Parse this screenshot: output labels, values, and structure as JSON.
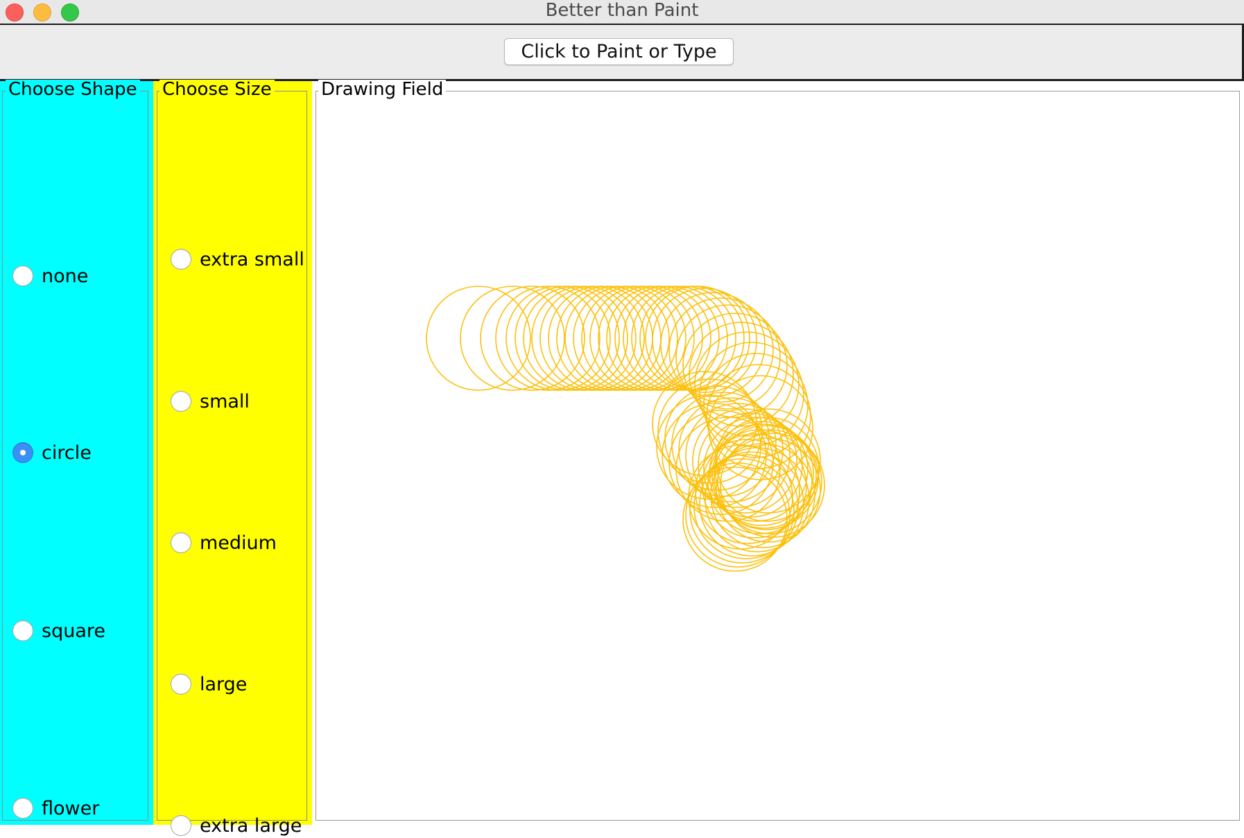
{
  "window": {
    "title": "Better than Paint",
    "traffic_lights": [
      "close-button",
      "minimize-button",
      "zoom-button"
    ]
  },
  "toolbar": {
    "paint_button_label": "Click to Paint or Type"
  },
  "shape_panel": {
    "legend": "Choose Shape",
    "background": "#00ffff",
    "options": [
      {
        "label": "none",
        "checked": false
      },
      {
        "label": "circle",
        "checked": true
      },
      {
        "label": "square",
        "checked": false
      },
      {
        "label": "flower",
        "checked": false
      }
    ]
  },
  "size_panel": {
    "legend": "Choose Size",
    "background": "#ffff00",
    "options": [
      {
        "label": "extra small",
        "checked": false
      },
      {
        "label": "small",
        "checked": false
      },
      {
        "label": "medium",
        "checked": false
      },
      {
        "label": "large",
        "checked": false
      },
      {
        "label": "extra large",
        "checked": false
      }
    ]
  },
  "drawing_field": {
    "legend": "Drawing Field",
    "stroke_color": "#fcc00c",
    "shape": "circle"
  }
}
